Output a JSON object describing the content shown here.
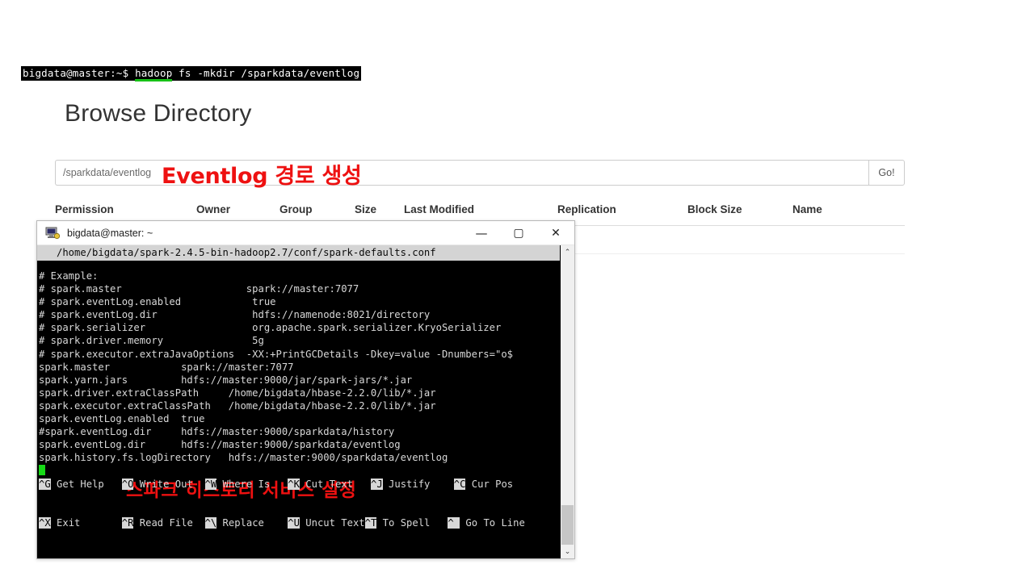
{
  "shell_strip": {
    "prompt": "bigdata@master:~$ ",
    "command": "hadoop fs -mkdir /sparkdata/eventlog",
    "cmd_head": "hadoop",
    "cmd_tail": " fs -mkdir /sparkdata/eventlog"
  },
  "browse": {
    "title": "Browse Directory",
    "path_value": "/sparkdata/eventlog",
    "path_placeholder": "/sparkdata/eventlog",
    "go_label": "Go!",
    "annotation": "Eventlog 경로 생성",
    "columns": [
      "Permission",
      "Owner",
      "Group",
      "Size",
      "Last Modified",
      "Replication",
      "Block Size",
      "Name"
    ]
  },
  "putty": {
    "title": "bigdata@master: ~",
    "icon": "putty-icon",
    "minimize": "—",
    "maximize": "▢",
    "close": "✕",
    "nano_header": "/home/bigdata/spark-2.4.5-bin-hadoop2.7/conf/spark-defaults.conf",
    "annotation": "스파크 히스토리 서비스 설정",
    "lines": [
      {
        "color": "cyan",
        "text": "# Example:"
      },
      {
        "color": "cyan",
        "text": "# spark.master                     spark://master:7077"
      },
      {
        "color": "cyan",
        "text": "# spark.eventLog.enabled            true"
      },
      {
        "color": "cyan",
        "text": "# spark.eventLog.dir                hdfs://namenode:8021/directory"
      },
      {
        "color": "cyan",
        "text": "# spark.serializer                  org.apache.spark.serializer.KryoSerializer"
      },
      {
        "color": "cyan",
        "text": "# spark.driver.memory               5g"
      },
      {
        "color": "cyan",
        "text": "# spark.executor.extraJavaOptions  -XX:+PrintGCDetails -Dkey=value -Dnumbers=\"o$"
      },
      {
        "color": "white",
        "text": "spark.master            spark://master:7077"
      },
      {
        "color": "white",
        "text": "spark.yarn.jars         hdfs://master:9000/jar/spark-jars/*.jar"
      },
      {
        "color": "white",
        "text": "spark.driver.extraClassPath     /home/bigdata/hbase-2.2.0/lib/*.jar"
      },
      {
        "color": "white",
        "text": "spark.executor.extraClassPath   /home/bigdata/hbase-2.2.0/lib/*.jar"
      },
      {
        "color": "white",
        "text": "spark.eventLog.enabled  true"
      },
      {
        "color": "cyan",
        "text": "#spark.eventLog.dir     hdfs://master:9000/sparkdata/history"
      },
      {
        "color": "white",
        "text": "spark.eventLog.dir      hdfs://master:9000/sparkdata/eventlog"
      },
      {
        "color": "white",
        "text": "spark.history.fs.logDirectory   hdfs://master:9000/sparkdata/eventlog"
      }
    ],
    "help_row1": [
      {
        "key": "^G",
        "label": " Get Help   "
      },
      {
        "key": "^O",
        "label": " Write Out  "
      },
      {
        "key": "^W",
        "label": " Where Is   "
      },
      {
        "key": "^K",
        "label": " Cut Text   "
      },
      {
        "key": "^J",
        "label": " Justify    "
      },
      {
        "key": "^C",
        "label": " Cur Pos"
      }
    ],
    "help_row2": [
      {
        "key": "^X",
        "label": " Exit       "
      },
      {
        "key": "^R",
        "label": " Read File  "
      },
      {
        "key": "^\\",
        "label": " Replace    "
      },
      {
        "key": "^U",
        "label": " Uncut Text"
      },
      {
        "key": "^T",
        "label": " To Spell   "
      },
      {
        "key": "^ ",
        "label": " Go To Line"
      }
    ],
    "scroll_up": "⌃",
    "scroll_down": "⌄"
  },
  "colors": {
    "annotation_red": "#ee1111",
    "terminal_bg": "#000000",
    "terminal_cyan": "#1fb8b8",
    "terminal_fg": "#d8d8d8",
    "cursor_green": "#16d916",
    "nano_bar": "#d4d4d4"
  }
}
